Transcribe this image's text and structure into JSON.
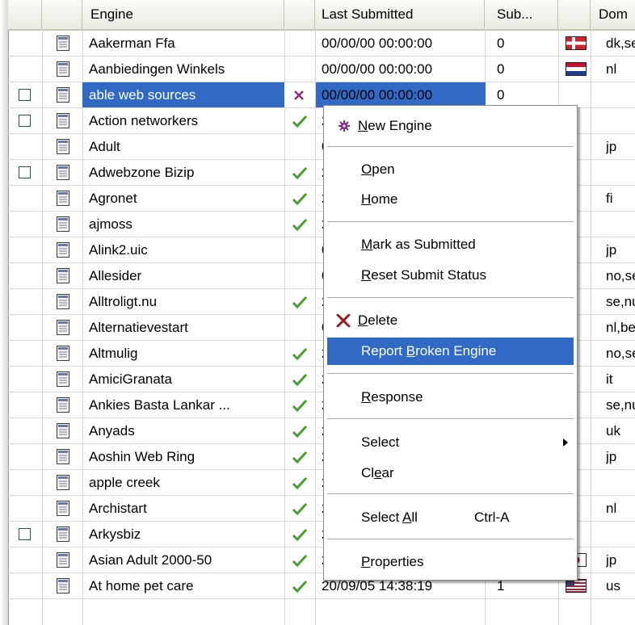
{
  "columns": {
    "engine": "Engine",
    "last_submitted": "Last Submitted",
    "sub": "Sub...",
    "domain": "Dom"
  },
  "rows": [
    {
      "name": "Aakerman Ffa",
      "status": "",
      "date": "00/00/00 00:00:00",
      "sub": "0",
      "flag": "denmark",
      "domain": "dk,se",
      "checkbox": false
    },
    {
      "name": "Aanbiedingen Winkels",
      "status": "",
      "date": "00/00/00 00:00:00",
      "sub": "0",
      "flag": "netherlands",
      "domain": "nl",
      "checkbox": false
    },
    {
      "name": "able web sources",
      "status": "x",
      "date": "00/00/00 00:00:00",
      "sub": "0",
      "flag": "",
      "domain": "",
      "checkbox": true,
      "selected": true
    },
    {
      "name": "Action networkers",
      "status": "check",
      "date": "2",
      "sub": "",
      "flag": "",
      "domain": "",
      "checkbox": true
    },
    {
      "name": "Adult",
      "status": "",
      "date": "0",
      "sub": "",
      "flag": "",
      "domain": "jp",
      "checkbox": false
    },
    {
      "name": "Adwebzone Bizip",
      "status": "check",
      "date": "2",
      "sub": "",
      "flag": "",
      "domain": "",
      "checkbox": true
    },
    {
      "name": "Agronet",
      "status": "check",
      "date": "2",
      "sub": "",
      "flag": "",
      "domain": "fi",
      "checkbox": false
    },
    {
      "name": "ajmoss",
      "status": "check",
      "date": "2",
      "sub": "",
      "flag": "",
      "domain": "",
      "checkbox": false
    },
    {
      "name": "Alink2.uic",
      "status": "",
      "date": "0",
      "sub": "",
      "flag": "",
      "domain": "jp",
      "checkbox": false
    },
    {
      "name": "Allesider",
      "status": "",
      "date": "0",
      "sub": "",
      "flag": "",
      "domain": "no,se",
      "checkbox": false
    },
    {
      "name": "Alltroligt.nu",
      "status": "check",
      "date": "2",
      "sub": "",
      "flag": "",
      "domain": "se,nu",
      "checkbox": false
    },
    {
      "name": "Alternatievestart",
      "status": "",
      "date": "0",
      "sub": "",
      "flag": "",
      "domain": "nl,be",
      "checkbox": false
    },
    {
      "name": "Altmulig",
      "status": "check",
      "date": "2",
      "sub": "",
      "flag": "",
      "domain": "no,se",
      "checkbox": false
    },
    {
      "name": "AmiciGranata",
      "status": "check",
      "date": "2",
      "sub": "",
      "flag": "",
      "domain": "it",
      "checkbox": false
    },
    {
      "name": "Ankies Basta Lankar ...",
      "status": "check",
      "date": "2",
      "sub": "",
      "flag": "",
      "domain": "se,nu",
      "checkbox": false
    },
    {
      "name": "Anyads",
      "status": "check",
      "date": "2",
      "sub": "",
      "flag": "",
      "domain": "uk",
      "checkbox": false
    },
    {
      "name": "Aoshin Web Ring",
      "status": "check",
      "date": "2",
      "sub": "",
      "flag": "",
      "domain": "jp",
      "checkbox": false
    },
    {
      "name": "apple creek",
      "status": "check",
      "date": "2",
      "sub": "",
      "flag": "",
      "domain": "",
      "checkbox": false
    },
    {
      "name": "Archistart",
      "status": "check",
      "date": "2",
      "sub": "",
      "flag": "",
      "domain": "nl",
      "checkbox": false
    },
    {
      "name": "Arkysbiz",
      "status": "check",
      "date": "2",
      "sub": "",
      "flag": "",
      "domain": "",
      "checkbox": true
    },
    {
      "name": "Asian Adult 2000-50",
      "status": "check",
      "date": "20/09/05 16:17:08",
      "sub": "1",
      "flag": "japan",
      "domain": "jp",
      "checkbox": false
    },
    {
      "name": "At home pet care",
      "status": "check",
      "date": "20/09/05 14:38:19",
      "sub": "1",
      "flag": "usa",
      "domain": "us",
      "checkbox": false
    }
  ],
  "menu": {
    "new_engine": {
      "pre": "",
      "u": "N",
      "post": "ew Engine"
    },
    "open": {
      "pre": "",
      "u": "O",
      "post": "pen"
    },
    "home": {
      "pre": "",
      "u": "H",
      "post": "ome"
    },
    "mark_submitted": {
      "pre": "",
      "u": "M",
      "post": "ark as Submitted"
    },
    "reset_status": {
      "pre": "",
      "u": "R",
      "post": "eset Submit Status"
    },
    "delete": {
      "pre": "",
      "u": "D",
      "post": "elete"
    },
    "report_broken": {
      "pre": "Report ",
      "u": "B",
      "post": "roken Engine"
    },
    "response": {
      "pre": "",
      "u": "R",
      "post": "esponse"
    },
    "select": "Select",
    "clear": {
      "pre": "Cl",
      "u": "e",
      "post": "ar"
    },
    "select_all": {
      "pre": "Select ",
      "u": "A",
      "post": "ll"
    },
    "select_all_shortcut": "Ctrl-A",
    "properties": {
      "pre": "",
      "u": "P",
      "post": "roperties"
    }
  },
  "colors": {
    "selection": "#316ac5",
    "check": "#3fa52b",
    "x_mark": "#8e2c7a",
    "delete_x": "#9b1a1a"
  },
  "icons": {
    "row_doc": "document-icon",
    "new_engine": "gear-icon",
    "delete": "delete-x-icon",
    "submenu": "triangle-right-icon"
  }
}
